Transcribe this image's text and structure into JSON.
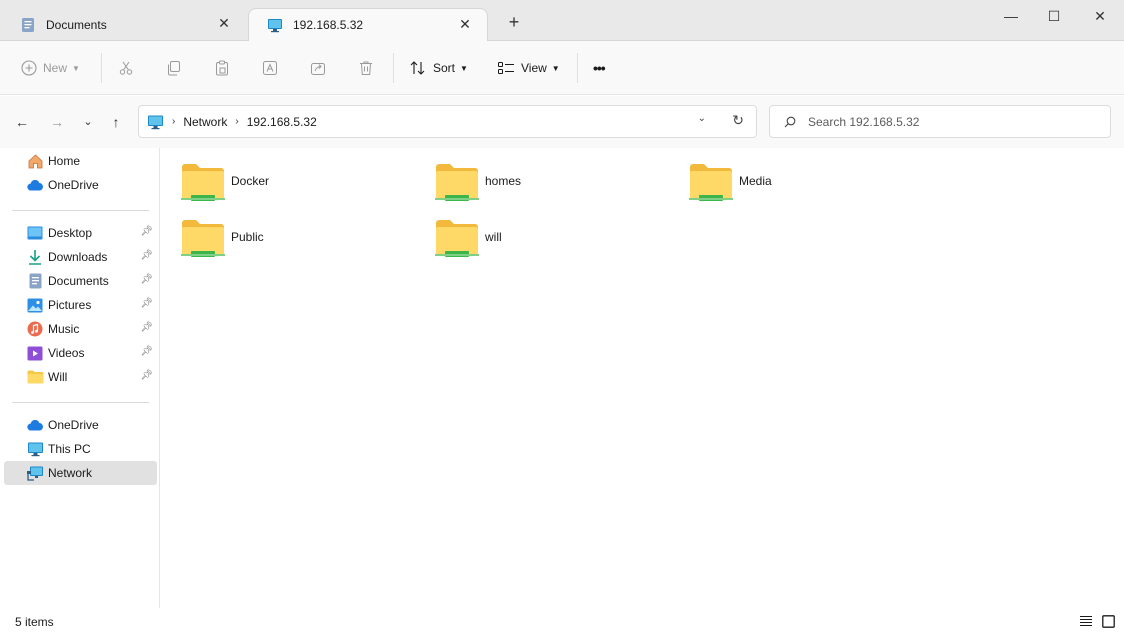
{
  "tabs": [
    {
      "label": "Documents",
      "icon": "document-icon",
      "active": false
    },
    {
      "label": "192.168.5.32",
      "icon": "monitor-icon",
      "active": true
    }
  ],
  "window_controls": {
    "minimize": "—",
    "maximize": "☐",
    "close": "✕"
  },
  "toolbar": {
    "new_label": "New",
    "sort_label": "Sort",
    "view_label": "View",
    "more_label": "•••"
  },
  "address": {
    "crumbs": [
      "Network",
      "192.168.5.32"
    ]
  },
  "search": {
    "placeholder": "Search 192.168.5.32"
  },
  "sidebar": {
    "top": [
      {
        "label": "Home",
        "icon": "home-icon"
      },
      {
        "label": "OneDrive",
        "icon": "cloud-icon"
      }
    ],
    "quick_access": [
      {
        "label": "Desktop",
        "icon": "desktop-icon"
      },
      {
        "label": "Downloads",
        "icon": "download-icon"
      },
      {
        "label": "Documents",
        "icon": "document-icon"
      },
      {
        "label": "Pictures",
        "icon": "pictures-icon"
      },
      {
        "label": "Music",
        "icon": "music-icon"
      },
      {
        "label": "Videos",
        "icon": "videos-icon"
      },
      {
        "label": "Will",
        "icon": "folder-icon"
      }
    ],
    "bottom": [
      {
        "label": "OneDrive",
        "icon": "cloud-icon"
      },
      {
        "label": "This PC",
        "icon": "monitor-icon"
      },
      {
        "label": "Network",
        "icon": "network-icon",
        "selected": true
      }
    ]
  },
  "folders": [
    {
      "name": "Docker"
    },
    {
      "name": "homes"
    },
    {
      "name": "Media"
    },
    {
      "name": "Public"
    },
    {
      "name": "will"
    }
  ],
  "status": {
    "item_count": "5 items"
  },
  "colors": {
    "folder": "#f6c84a",
    "share_bar": "#3cb54a",
    "selected_bg": "#e1e1e1",
    "accent": "#0067c0"
  }
}
